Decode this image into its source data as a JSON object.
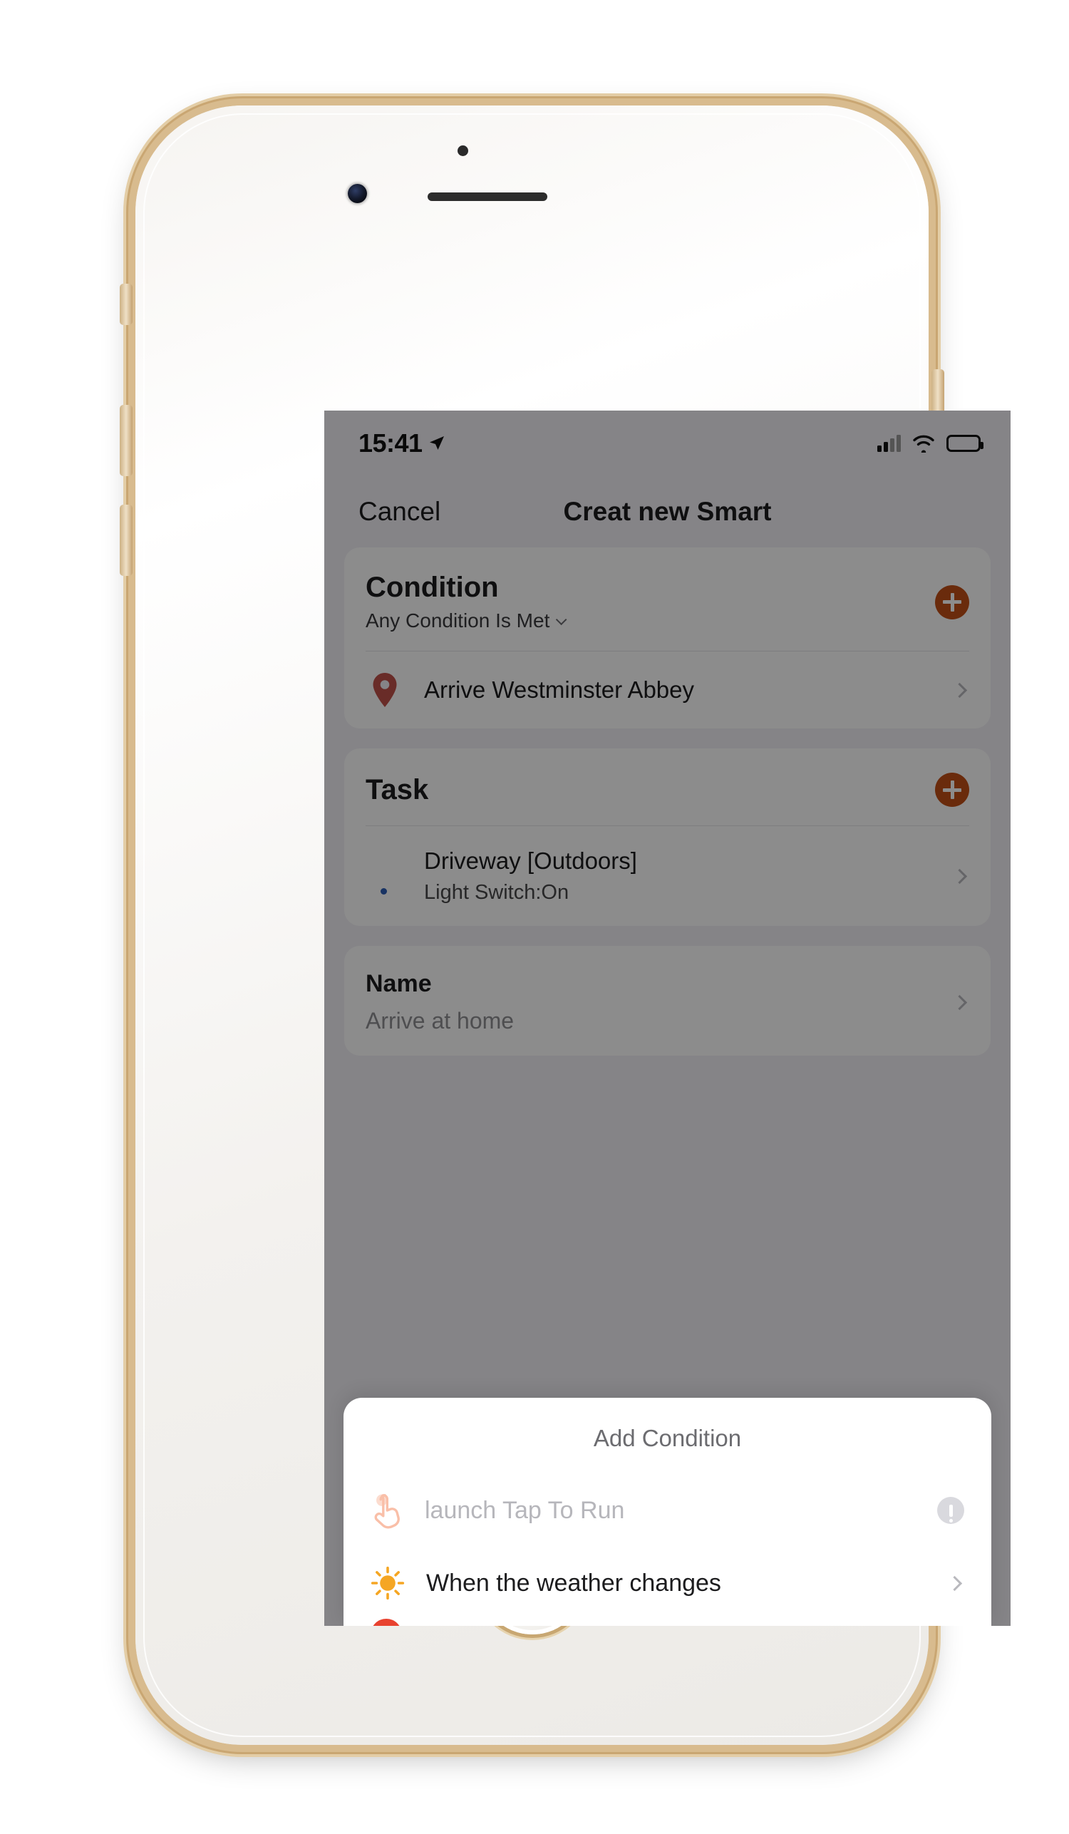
{
  "colors": {
    "accent_orange": "#C24F17",
    "pin_red": "#C0504A",
    "sun_yellow": "#F5A623",
    "tap_icon_peach": "#F9BFA8",
    "cut_icon_red": "#E8422F",
    "dim_overlay": "rgba(0,0,0,0.45)",
    "frame_gold": "#C9A672"
  },
  "status_bar": {
    "time": "15:41",
    "location_icon": "location-arrow-icon",
    "signal_icon": "cellular-signal-icon",
    "wifi_icon": "wifi-icon",
    "battery_icon": "battery-icon"
  },
  "nav": {
    "cancel_label": "Cancel",
    "title": "Creat new Smart"
  },
  "condition_card": {
    "title": "Condition",
    "subtitle": "Any Condition Is Met",
    "chevron_icon": "chevron-down-icon",
    "add_icon": "plus-icon",
    "rows": [
      {
        "icon": "map-pin-icon",
        "title": "Arrive Westminster Abbey",
        "chevron": "chevron-right-icon"
      }
    ]
  },
  "task_card": {
    "title": "Task",
    "add_icon": "plus-icon",
    "rows": [
      {
        "icon": "smart-device-icon",
        "title": "Driveway [Outdoors]",
        "subtitle": "Light Switch:On",
        "chevron": "chevron-right-icon"
      }
    ]
  },
  "name_card": {
    "label": "Name",
    "value": "Arrive at home",
    "chevron": "chevron-right-icon"
  },
  "bottom_sheet": {
    "title": "Add Condition",
    "rows": [
      {
        "icon": "hand-tap-icon",
        "label": "launch Tap To Run",
        "trailing": "info-exclamation-icon",
        "disabled": true
      },
      {
        "icon": "sun-icon",
        "label": "When the weather changes",
        "trailing": "chevron-right-icon",
        "disabled": false
      }
    ]
  },
  "device": {
    "home_button": "home-button",
    "front_camera": "front-camera-icon",
    "earpiece": "earpiece-speaker"
  }
}
